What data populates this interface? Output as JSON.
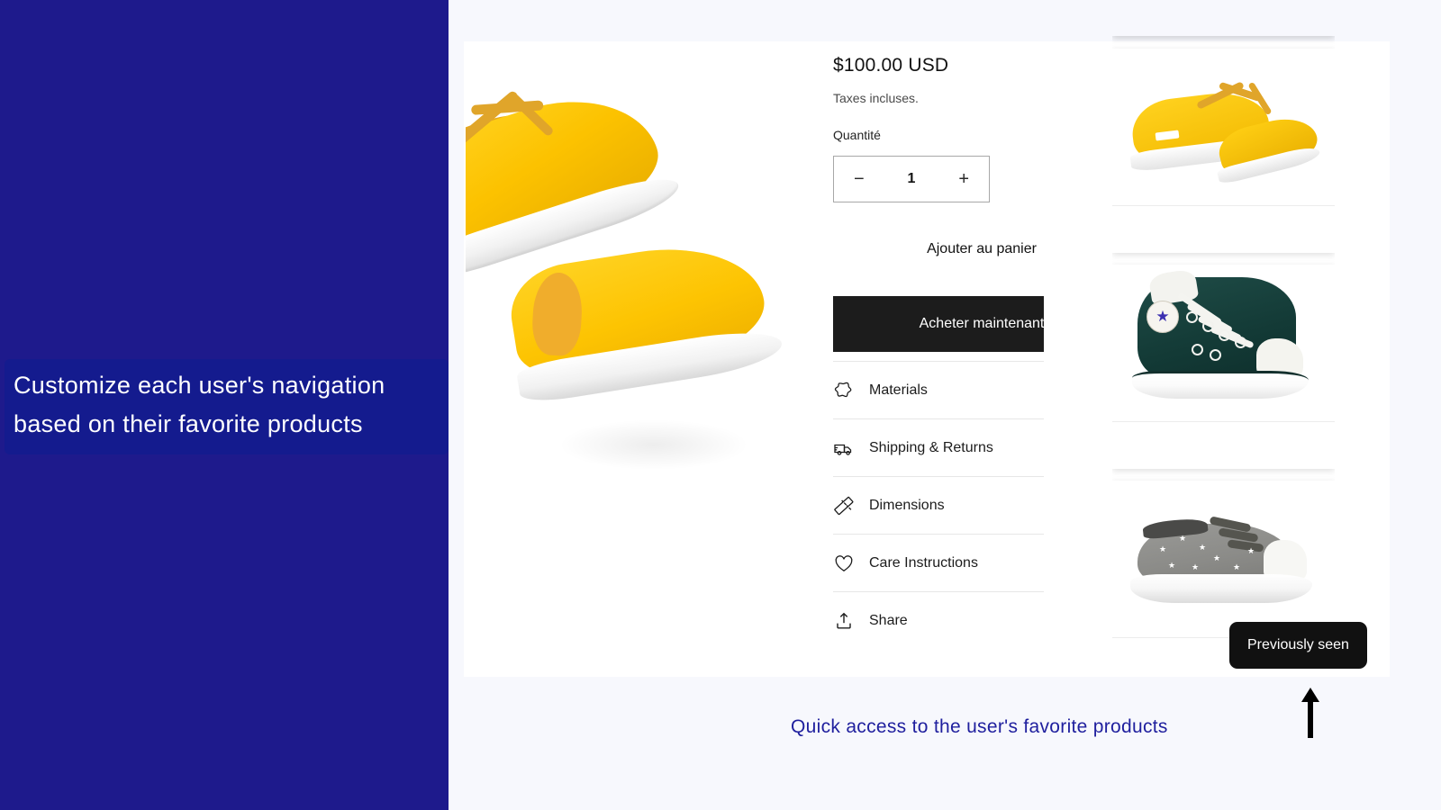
{
  "annotations": {
    "left_callout_lines": [
      "Customize each user's navigation",
      "based on their favorite products"
    ],
    "bottom_note": "Quick access to the user's favorite products",
    "arrow_icon": "arrow-up-icon",
    "panel_color": "#1e1a8c",
    "callout_color": "#141b8e",
    "note_color": "#1f1f9e"
  },
  "product": {
    "price": "$100.00 USD",
    "tax_note": "Taxes incluses.",
    "quantity_label": "Quantité",
    "quantity_decrease": "−",
    "quantity_value": "1",
    "quantity_increase": "+",
    "add_to_cart_label": "Ajouter au panier",
    "buy_now_label": "Acheter maintenant",
    "buy_now_bg": "#1c1c1c",
    "main_image_alt": "yellow canvas sneakers close-up"
  },
  "accordion": {
    "rows": [
      {
        "label": "Materials",
        "icon": "leather-hide-icon"
      },
      {
        "label": "Shipping & Returns",
        "icon": "truck-icon"
      },
      {
        "label": "Dimensions",
        "icon": "ruler-icon"
      },
      {
        "label": "Care Instructions",
        "icon": "heart-icon"
      }
    ],
    "share": {
      "label": "Share",
      "icon": "share-upload-icon"
    }
  },
  "thumbnail_rail": {
    "tooltip": "Previously seen",
    "tooltip_bg": "#111111",
    "items": [
      {
        "alt": "yellow canvas sneakers pair",
        "caption": ""
      },
      {
        "alt": "dark green high-top sneaker",
        "caption": ""
      },
      {
        "alt": "gray star-print low-top sneaker",
        "caption": ""
      }
    ]
  }
}
